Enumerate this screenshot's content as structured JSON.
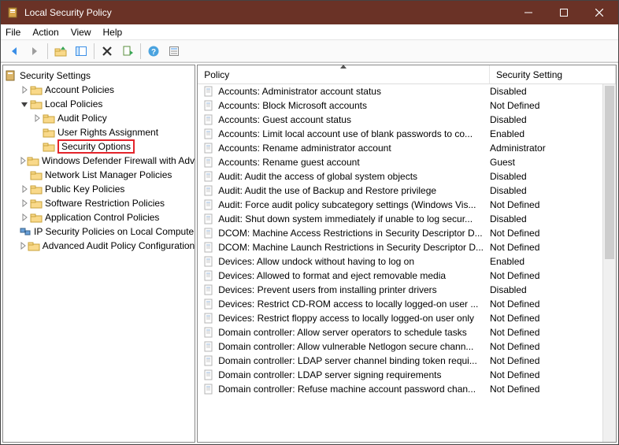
{
  "window": {
    "title": "Local Security Policy"
  },
  "menubar": {
    "items": [
      "File",
      "Action",
      "View",
      "Help"
    ]
  },
  "tree": {
    "root_label": "Security Settings",
    "nodes": [
      {
        "label": "Account Policies",
        "expandable": true,
        "expanded": false,
        "icon": "folder"
      },
      {
        "label": "Local Policies",
        "expandable": true,
        "expanded": true,
        "icon": "folder",
        "children": [
          {
            "label": "Audit Policy",
            "expandable": true,
            "expanded": false,
            "icon": "folder"
          },
          {
            "label": "User Rights Assignment",
            "expandable": false,
            "icon": "folder"
          },
          {
            "label": "Security Options",
            "expandable": false,
            "icon": "folder",
            "highlight": true,
            "selected": true
          }
        ]
      },
      {
        "label": "Windows Defender Firewall with Advanced Security",
        "expandable": true,
        "expanded": false,
        "icon": "folder"
      },
      {
        "label": "Network List Manager Policies",
        "expandable": false,
        "icon": "folder"
      },
      {
        "label": "Public Key Policies",
        "expandable": true,
        "expanded": false,
        "icon": "folder"
      },
      {
        "label": "Software Restriction Policies",
        "expandable": true,
        "expanded": false,
        "icon": "folder"
      },
      {
        "label": "Application Control Policies",
        "expandable": true,
        "expanded": false,
        "icon": "folder"
      },
      {
        "label": "IP Security Policies on Local Computer",
        "expandable": false,
        "icon": "ipsec"
      },
      {
        "label": "Advanced Audit Policy Configuration",
        "expandable": true,
        "expanded": false,
        "icon": "folder"
      }
    ]
  },
  "list": {
    "columns": {
      "policy": "Policy",
      "setting": "Security Setting"
    },
    "rows": [
      {
        "policy": "Accounts: Administrator account status",
        "setting": "Disabled"
      },
      {
        "policy": "Accounts: Block Microsoft accounts",
        "setting": "Not Defined"
      },
      {
        "policy": "Accounts: Guest account status",
        "setting": "Disabled"
      },
      {
        "policy": "Accounts: Limit local account use of blank passwords to co...",
        "setting": "Enabled"
      },
      {
        "policy": "Accounts: Rename administrator account",
        "setting": "Administrator"
      },
      {
        "policy": "Accounts: Rename guest account",
        "setting": "Guest"
      },
      {
        "policy": "Audit: Audit the access of global system objects",
        "setting": "Disabled"
      },
      {
        "policy": "Audit: Audit the use of Backup and Restore privilege",
        "setting": "Disabled"
      },
      {
        "policy": "Audit: Force audit policy subcategory settings (Windows Vis...",
        "setting": "Not Defined"
      },
      {
        "policy": "Audit: Shut down system immediately if unable to log secur...",
        "setting": "Disabled"
      },
      {
        "policy": "DCOM: Machine Access Restrictions in Security Descriptor D...",
        "setting": "Not Defined"
      },
      {
        "policy": "DCOM: Machine Launch Restrictions in Security Descriptor D...",
        "setting": "Not Defined"
      },
      {
        "policy": "Devices: Allow undock without having to log on",
        "setting": "Enabled"
      },
      {
        "policy": "Devices: Allowed to format and eject removable media",
        "setting": "Not Defined"
      },
      {
        "policy": "Devices: Prevent users from installing printer drivers",
        "setting": "Disabled"
      },
      {
        "policy": "Devices: Restrict CD-ROM access to locally logged-on user ...",
        "setting": "Not Defined"
      },
      {
        "policy": "Devices: Restrict floppy access to locally logged-on user only",
        "setting": "Not Defined"
      },
      {
        "policy": "Domain controller: Allow server operators to schedule tasks",
        "setting": "Not Defined"
      },
      {
        "policy": "Domain controller: Allow vulnerable Netlogon secure chann...",
        "setting": "Not Defined"
      },
      {
        "policy": "Domain controller: LDAP server channel binding token requi...",
        "setting": "Not Defined"
      },
      {
        "policy": "Domain controller: LDAP server signing requirements",
        "setting": "Not Defined"
      },
      {
        "policy": "Domain controller: Refuse machine account password chan...",
        "setting": "Not Defined"
      }
    ]
  }
}
